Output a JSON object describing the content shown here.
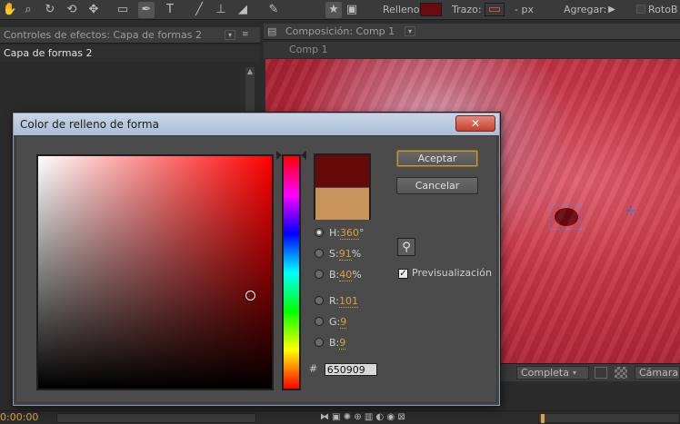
{
  "toolbar": {
    "tools": [
      "hand-icon",
      "zoom-icon",
      "rotate-icon",
      "orbit-icon",
      "rectangle-icon",
      "pen-icon",
      "text-icon",
      "brush-icon",
      "clone-stamp-icon",
      "eraser-icon",
      "puppet-icon",
      "star-icon",
      "camera-icon"
    ],
    "fill_label": "Relleno",
    "fill_color": "#6b0a10",
    "stroke_label": "Trazo:",
    "stroke_units": "- px",
    "add_label": "Agregar:",
    "roto_label": "RotoB"
  },
  "left_panel": {
    "tab_label": "Controles de efectos: Capa de formas 2",
    "layer_name": "Capa de formas 2"
  },
  "comp_panel": {
    "tab_label": "Composición: Comp 1",
    "sub_label": "Comp 1",
    "quality": "Completa",
    "camera": "Cámara a"
  },
  "timecode": "0:00:00",
  "dialog": {
    "title": "Color de relleno de forma",
    "close_glyph": "✕",
    "ok_label": "Aceptar",
    "cancel_label": "Cancelar",
    "preview_label": "Previsualización",
    "fields": [
      {
        "key": "H",
        "label": "H:",
        "value": "360",
        "unit": "°",
        "checked": true
      },
      {
        "key": "S",
        "label": "S:",
        "value": "91",
        "unit": "%",
        "checked": false
      },
      {
        "key": "B",
        "label": "B:",
        "value": "40",
        "unit": "%",
        "checked": false
      },
      {
        "key": "R",
        "label": "R:",
        "value": "101",
        "unit": "",
        "checked": false
      },
      {
        "key": "G",
        "label": "G:",
        "value": "9",
        "unit": "",
        "checked": false
      },
      {
        "key": "Bl",
        "label": "B:",
        "value": "9",
        "unit": "",
        "checked": false
      }
    ],
    "hex_prefix": "#",
    "hex_value": "650909",
    "new_color": "#650909",
    "old_color": "#c8945a",
    "saturation": 0.91,
    "brightness": 0.4,
    "hue": 360
  }
}
